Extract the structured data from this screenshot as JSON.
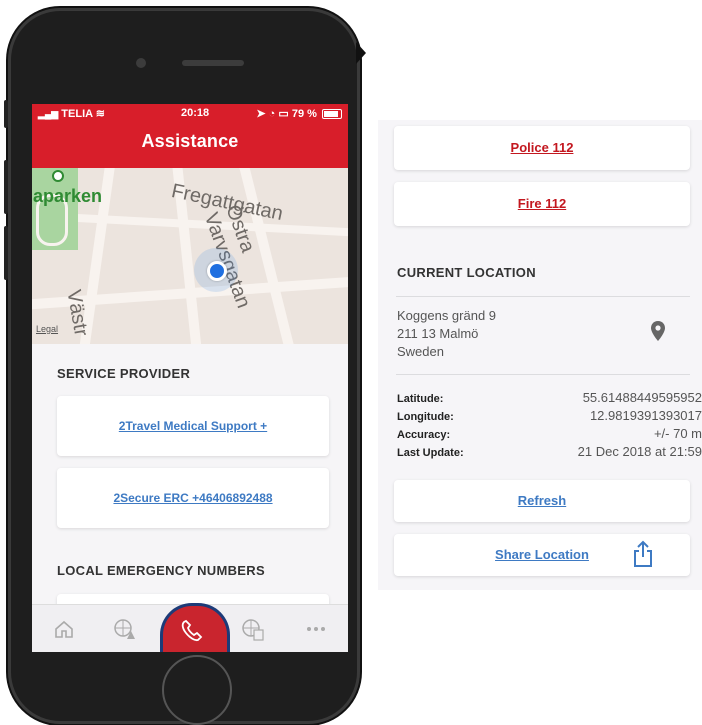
{
  "phone": {
    "status": {
      "carrier": "TELIA",
      "time": "20:18",
      "battery": "79 %"
    },
    "nav_title": "Assistance",
    "map": {
      "park_label": "iaparken",
      "street_1": "Fregattgatan",
      "street_2": "Östra Varvsgatan",
      "street_3": "Västr",
      "legal": "Legal"
    },
    "service_provider": {
      "header": "SERVICE PROVIDER",
      "items": [
        {
          "label": "2Travel Medical Support +"
        },
        {
          "label": "2Secure ERC +46406892488"
        }
      ]
    },
    "local_emergency": {
      "header": "LOCAL EMERGENCY NUMBERS"
    },
    "tabbar": {
      "tabs": [
        {
          "icon": "home-icon"
        },
        {
          "icon": "globe-alert-icon"
        },
        {
          "icon": "phone-call-icon",
          "active": true
        },
        {
          "icon": "globe-document-icon"
        },
        {
          "icon": "more-icon"
        }
      ]
    }
  },
  "panel": {
    "emergency": [
      {
        "label": "Police 112"
      },
      {
        "label": "Fire 112"
      }
    ],
    "current_location": {
      "header": "CURRENT LOCATION",
      "address": [
        "Koggens gränd 9",
        "211 13 Malmö",
        "Sweden"
      ],
      "latitude_label": "Latitude:",
      "latitude": "55.61488449595952",
      "longitude_label": "Longitude:",
      "longitude": "12.9819391393017",
      "accuracy_label": "Accuracy:",
      "accuracy": "+/- 70 m",
      "last_update_label": "Last Update:",
      "last_update": "21 Dec 2018 at 21:59"
    },
    "refresh_label": "Refresh",
    "share_label": "Share Location"
  },
  "colors": {
    "brand_red": "#d81e2a",
    "link_blue": "#3e7ac3",
    "link_red": "#c3171f"
  }
}
